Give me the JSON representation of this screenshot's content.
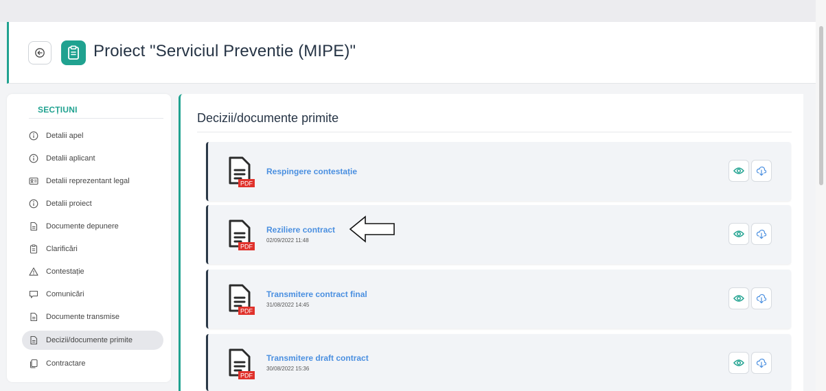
{
  "colors": {
    "accent": "#20a290",
    "link": "#4a8fe0",
    "pdf_badge": "#e0312b",
    "dark": "#2a3847"
  },
  "header": {
    "title": "Proiect \"Serviciul Preventie (MIPE)\"",
    "back_icon": "back-arrow-icon",
    "title_icon": "clipboard-list-icon"
  },
  "sidebar": {
    "title": "SECȚIUNI",
    "items": [
      {
        "label": "Detalii apel",
        "icon": "info-icon"
      },
      {
        "label": "Detalii aplicant",
        "icon": "info-icon"
      },
      {
        "label": "Detalii reprezentant legal",
        "icon": "id-card-icon"
      },
      {
        "label": "Detalii proiect",
        "icon": "info-icon"
      },
      {
        "label": "Documente depunere",
        "icon": "document-icon"
      },
      {
        "label": "Clarificări",
        "icon": "clipboard-icon"
      },
      {
        "label": "Contestație",
        "icon": "warning-icon"
      },
      {
        "label": "Comunicări",
        "icon": "chat-icon"
      },
      {
        "label": "Documente transmise",
        "icon": "document-icon"
      },
      {
        "label": "Decizii/documente primite",
        "icon": "document-icon",
        "active": true
      },
      {
        "label": "Contractare",
        "icon": "copy-icon"
      }
    ]
  },
  "main": {
    "title": "Decizii/documente primite",
    "documents": [
      {
        "name": "Respingere contestație",
        "date": "",
        "badge": "PDF"
      },
      {
        "name": "Reziliere contract",
        "date": "02/09/2022 11:48",
        "badge": "PDF"
      },
      {
        "name": "Transmitere contract final",
        "date": "31/08/2022 14:45",
        "badge": "PDF"
      },
      {
        "name": "Transmitere draft contract",
        "date": "30/08/2022 15:36",
        "badge": "PDF"
      }
    ]
  }
}
